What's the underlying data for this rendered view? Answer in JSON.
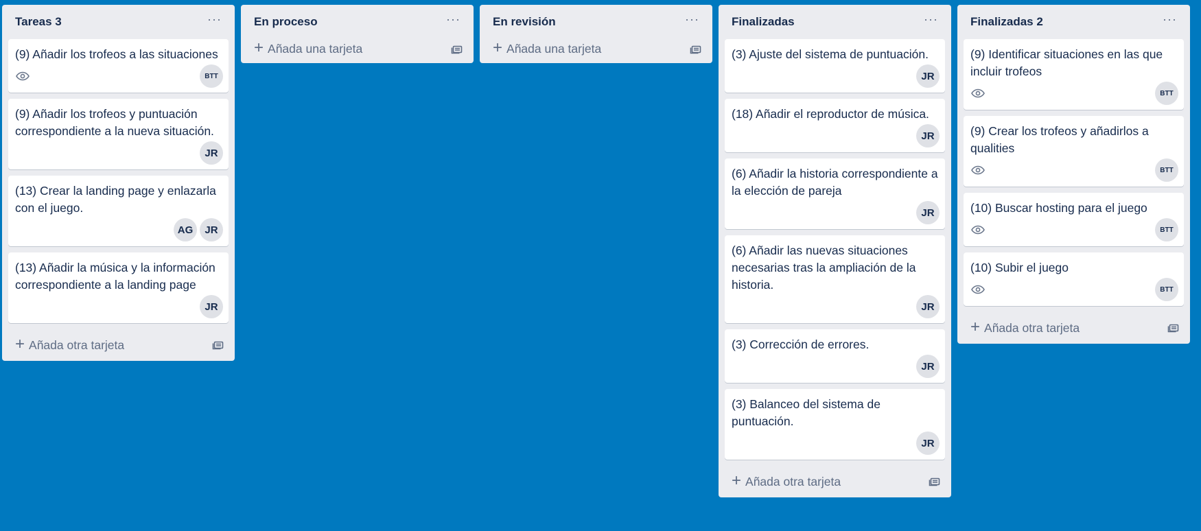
{
  "lists": [
    {
      "title": "Tareas 3",
      "menu": "···",
      "cards": [
        {
          "title": "(9) Añadir los trofeos a las situaciones",
          "watch": true,
          "members": [
            "BTT"
          ]
        },
        {
          "title": "(9) Añadir los trofeos y puntuación correspondiente a la nueva situación.",
          "watch": false,
          "members": [
            "JR"
          ]
        },
        {
          "title": "(13) Crear la landing page y enlazarla con el juego.",
          "watch": false,
          "members": [
            "AG",
            "JR"
          ]
        },
        {
          "title": "(13) Añadir la música y la información correspondiente a la landing page",
          "watch": false,
          "members": [
            "JR"
          ]
        }
      ],
      "add_label": "Añada otra tarjeta"
    },
    {
      "title": "En proceso",
      "menu": "···",
      "cards": [],
      "add_label": "Añada una tarjeta"
    },
    {
      "title": "En revisión",
      "menu": "···",
      "cards": [],
      "add_label": "Añada una tarjeta"
    },
    {
      "title": "Finalizadas",
      "menu": "···",
      "cards": [
        {
          "title": "(3) Ajuste del sistema de puntuación.",
          "watch": false,
          "members": [
            "JR"
          ]
        },
        {
          "title": "(18) Añadir el reproductor de música.",
          "watch": false,
          "members": [
            "JR"
          ]
        },
        {
          "title": "(6) Añadir la historia correspondiente a la elección de pareja",
          "watch": false,
          "members": [
            "JR"
          ]
        },
        {
          "title": "(6) Añadir las nuevas situaciones necesarias tras la ampliación de la historia.",
          "watch": false,
          "members": [
            "JR"
          ]
        },
        {
          "title": "(3) Corrección de errores.",
          "watch": false,
          "members": [
            "JR"
          ]
        },
        {
          "title": "(3) Balanceo del sistema de puntuación.",
          "watch": false,
          "members": [
            "JR"
          ]
        }
      ],
      "add_label": "Añada otra tarjeta"
    },
    {
      "title": "Finalizadas 2",
      "menu": "···",
      "cards": [
        {
          "title": "(9) Identificar situaciones en las que incluir trofeos",
          "watch": true,
          "members": [
            "BTT"
          ]
        },
        {
          "title": "(9) Crear los trofeos y añadirlos a qualities",
          "watch": true,
          "members": [
            "BTT"
          ]
        },
        {
          "title": "(10) Buscar hosting para el juego",
          "watch": true,
          "members": [
            "BTT"
          ]
        },
        {
          "title": "(10) Subir el juego",
          "watch": true,
          "members": [
            "BTT"
          ]
        }
      ],
      "add_label": "Añada otra tarjeta"
    }
  ],
  "icons": {
    "list_menu": "ellipsis-icon",
    "watch": "eye-icon",
    "add": "plus-icon",
    "template": "card-template-icon"
  }
}
